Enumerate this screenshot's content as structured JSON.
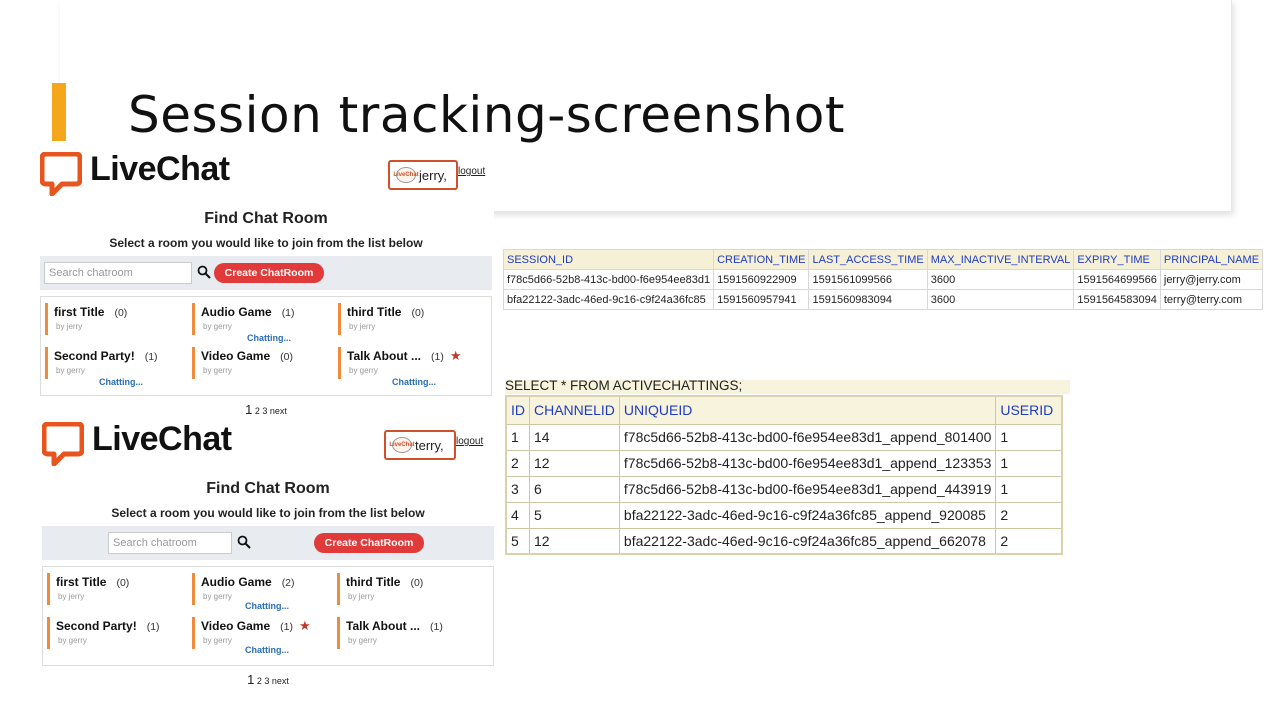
{
  "slide": {
    "title": "Session tracking-screenshot"
  },
  "colors": {
    "accent": "#f5a71c",
    "brand": "#e8541e",
    "button": "#e03a3a",
    "link": "#2a6db8",
    "table_header": "#1f3bc4"
  },
  "livechat": [
    {
      "logo_text": "LiveChat",
      "user": "jerry,",
      "avatar_text": "LiveChat",
      "logout": "logout",
      "find_title": "Find Chat Room",
      "find_sub": "Select a room you would like to join from the list below",
      "search_placeholder": "Search chatroom",
      "create_button": "Create ChatRoom",
      "rooms": [
        {
          "name": "first Title",
          "count": "(0)",
          "by": "by jerry",
          "chatting": "",
          "star": ""
        },
        {
          "name": "Audio Game",
          "count": "(1)",
          "by": "by gerry",
          "chatting": "Chatting...",
          "star": ""
        },
        {
          "name": "third Title",
          "count": "(0)",
          "by": "by jerry",
          "chatting": "",
          "star": ""
        },
        {
          "name": "Second Party!",
          "count": "(1)",
          "by": "by gerry",
          "chatting": "Chatting...",
          "star": ""
        },
        {
          "name": "Video Game",
          "count": "(0)",
          "by": "by gerry",
          "chatting": "",
          "star": ""
        },
        {
          "name": "Talk About ...",
          "count": "(1)",
          "by": "by gerry",
          "chatting": "Chatting...",
          "star": "★"
        }
      ],
      "pagination": {
        "current": "1",
        "others": "2 3 next"
      }
    },
    {
      "logo_text": "LiveChat",
      "user": "terry,",
      "avatar_text": "LiveChat",
      "logout": "logout",
      "find_title": "Find Chat Room",
      "find_sub": "Select a room you would like to join from the list below",
      "search_placeholder": "Search chatroom",
      "create_button": "Create ChatRoom",
      "rooms": [
        {
          "name": "first Title",
          "count": "(0)",
          "by": "by jerry",
          "chatting": "",
          "star": ""
        },
        {
          "name": "Audio Game",
          "count": "(2)",
          "by": "by gerry",
          "chatting": "Chatting...",
          "star": ""
        },
        {
          "name": "third Title",
          "count": "(0)",
          "by": "by jerry",
          "chatting": "",
          "star": ""
        },
        {
          "name": "Second Party!",
          "count": "(1)",
          "by": "by gerry",
          "chatting": "",
          "star": ""
        },
        {
          "name": "Video Game",
          "count": "(1)",
          "by": "by gerry",
          "chatting": "Chatting...",
          "star": "★"
        },
        {
          "name": "Talk About ...",
          "count": "(1)",
          "by": "by gerry",
          "chatting": "",
          "star": ""
        }
      ],
      "pagination": {
        "current": "1",
        "others": "2 3 next"
      }
    }
  ],
  "session_table": {
    "headers": [
      "SESSION_ID",
      "CREATION_TIME",
      "LAST_ACCESS_TIME",
      "MAX_INACTIVE_INTERVAL",
      "EXPIRY_TIME",
      "PRINCIPAL_NAME"
    ],
    "rows": [
      [
        "f78c5d66-52b8-413c-bd00-f6e954ee83d1",
        "1591560922909",
        "1591561099566",
        "3600",
        "1591564699566",
        "jerry@jerry.com"
      ],
      [
        "bfa22122-3adc-46ed-9c16-c9f24a36fc85",
        "1591560957941",
        "1591560983094",
        "3600",
        "1591564583094",
        "terry@terry.com"
      ]
    ]
  },
  "active_chattings": {
    "query": "SELECT * FROM ACTIVECHATTINGS;",
    "headers": [
      "ID",
      "CHANNELID",
      "UNIQUEID",
      "USERID"
    ],
    "rows": [
      [
        "1",
        "14",
        "f78c5d66-52b8-413c-bd00-f6e954ee83d1_append_801400",
        "1"
      ],
      [
        "2",
        "12",
        "f78c5d66-52b8-413c-bd00-f6e954ee83d1_append_123353",
        "1"
      ],
      [
        "3",
        "6",
        "f78c5d66-52b8-413c-bd00-f6e954ee83d1_append_443919",
        "1"
      ],
      [
        "4",
        "5",
        "bfa22122-3adc-46ed-9c16-c9f24a36fc85_append_920085",
        "2"
      ],
      [
        "5",
        "12",
        "bfa22122-3adc-46ed-9c16-c9f24a36fc85_append_662078",
        "2"
      ]
    ]
  }
}
